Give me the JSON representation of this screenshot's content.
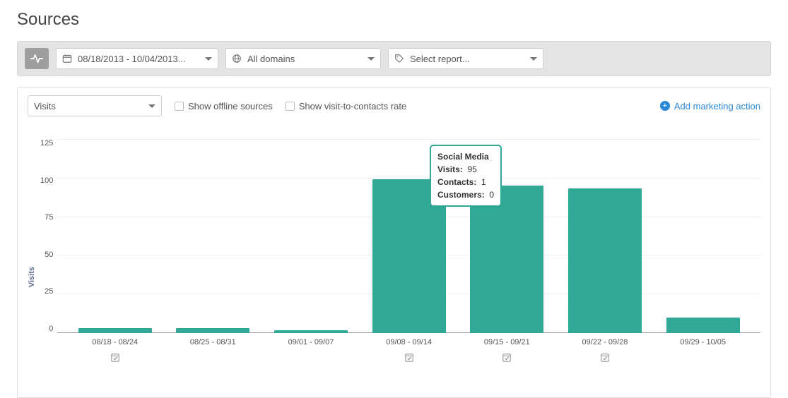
{
  "page": {
    "title": "Sources"
  },
  "filters": {
    "date_range_label": "08/18/2013 - 10/04/2013...",
    "domain_label": "All domains",
    "report_label": "Select report..."
  },
  "card": {
    "metric_selector": "Visits",
    "offline_checkbox_label": "Show offline sources",
    "vtc_checkbox_label": "Show visit-to-contacts rate",
    "add_action_label": "Add marketing action"
  },
  "chart_data": {
    "type": "bar",
    "title": "",
    "xlabel": "",
    "ylabel": "Visits",
    "ylim": [
      0,
      125
    ],
    "yticks": [
      0,
      25,
      50,
      75,
      100,
      125
    ],
    "categories": [
      "08/18 - 08/24",
      "08/25 - 08/31",
      "09/01 - 09/07",
      "09/08 - 09/14",
      "09/15 - 09/21",
      "09/22 - 09/28",
      "09/29 - 10/05"
    ],
    "values": [
      3,
      3,
      2,
      99,
      95,
      93,
      10
    ],
    "markers": [
      true,
      false,
      false,
      true,
      true,
      true,
      false
    ],
    "color": "#32a996"
  },
  "tooltip": {
    "title": "Social Media",
    "rows": [
      {
        "k": "Visits:",
        "v": "95"
      },
      {
        "k": "Contacts:",
        "v": "1"
      },
      {
        "k": "Customers:",
        "v": "0"
      }
    ],
    "anchor_index": 4
  }
}
